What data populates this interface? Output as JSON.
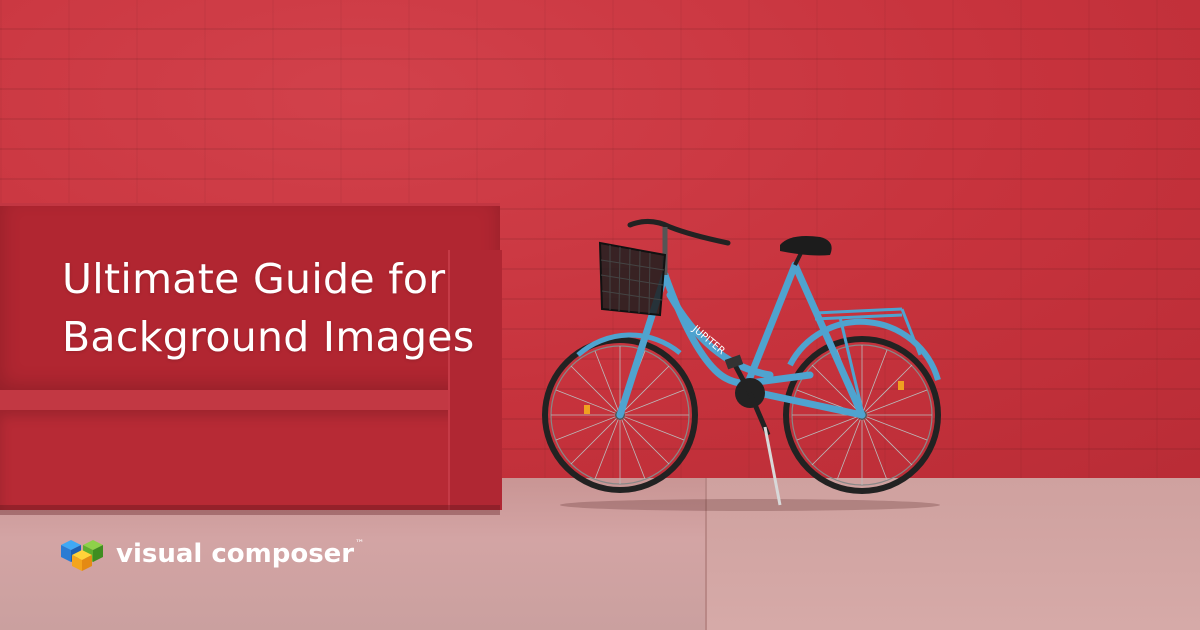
{
  "headline": {
    "line1": "Ultimate Guide for",
    "line2": "Background Images"
  },
  "brand": {
    "name": "visual composer",
    "trademark": "™"
  },
  "scene": {
    "bike_text": "JUPITER",
    "colors": {
      "wall": "#c8343e",
      "bench": "#b12631",
      "ground": "#d3a4a4",
      "bike_frame": "#4fa3cf",
      "text": "#ffffff"
    }
  }
}
